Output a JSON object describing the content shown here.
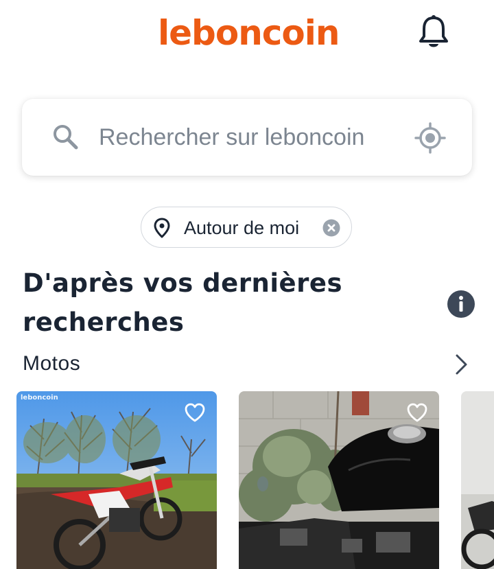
{
  "header": {
    "logo_text": "leboncoin",
    "brand_color": "#ec5a13",
    "bell_icon": "bell-icon"
  },
  "search": {
    "placeholder": "Rechercher sur leboncoin",
    "left_icon": "search-icon",
    "right_icon": "locate-icon"
  },
  "location_chip": {
    "label": "Autour de moi",
    "icon": "location-pin-icon",
    "clear_icon": "clear-icon"
  },
  "section": {
    "title": "D'après vos dernières recherches",
    "info_icon": "info-icon",
    "subsection_label": "Motos",
    "chevron_icon": "chevron-right-icon"
  },
  "listings": [
    {
      "watermark": "leboncoin",
      "favorite_icon": "heart-icon"
    },
    {
      "watermark": "",
      "favorite_icon": "heart-icon"
    },
    {
      "watermark": "",
      "favorite_icon": ""
    }
  ]
}
